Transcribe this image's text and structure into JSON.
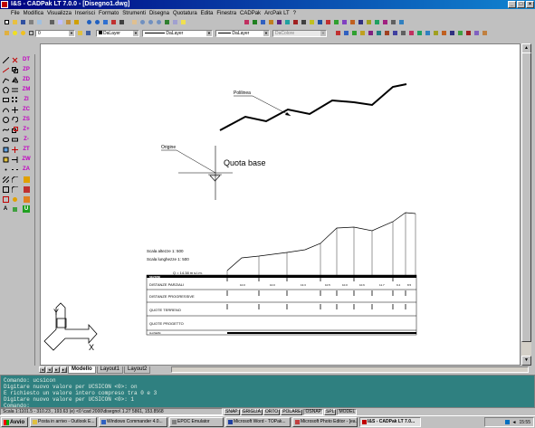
{
  "window": {
    "title": "I&S - CADPak LT 7.0.0 - [Disegno1.dwg]",
    "controls": [
      "_",
      "□",
      "×"
    ]
  },
  "menu": [
    "File",
    "Modifica",
    "Visualizza",
    "Inserisci",
    "Formato",
    "Strumenti",
    "Disegna",
    "Quotatura",
    "Edita",
    "Finestra",
    "CADPak",
    "ArcPak LT",
    "?"
  ],
  "properties_toolbar": {
    "layer_value": "0",
    "color_value": "DaLayer",
    "linetype_value": "DaLayer",
    "lineweight_value": "DaLayer",
    "plotstyle_value": "DaColore"
  },
  "left_toolbar": {
    "letters": [
      "DT",
      "ZP",
      "ZD",
      "ZM",
      "ZI",
      "ZC",
      "ZS",
      "Z+",
      "Z-",
      "ZT",
      "ZW",
      "ZA",
      "U"
    ]
  },
  "drawing": {
    "polyline_label": "Polilinea",
    "origin_label": "Origine",
    "quota_label": "Quota base",
    "scale_heights": "Scala altezze 1: 500",
    "scale_lengths": "Scala lunghezze 1: 500",
    "datum_label": "Q = 14.38 m s.l.m.",
    "table_header": "SEZIONI",
    "row_labels": [
      "DISTANZE PARZIALI",
      "DISTANZE PROGRESSIVE",
      "QUOTE TERRENO",
      "QUOTE PROGETTO",
      "ALLINEAM."
    ],
    "partial_distances": [
      "10.0",
      "10.0",
      "13.3",
      "10.5",
      "10.0",
      "10.6",
      "11.7",
      "9.4",
      "8.5"
    ],
    "ucs_y": "Y",
    "ucs_x": "X"
  },
  "tabs": {
    "nav": [
      "|◄",
      "◄",
      "►",
      "►|"
    ],
    "items": [
      "Modello",
      "Layout1",
      "Layout2"
    ],
    "active": "Modello"
  },
  "command_lines": [
    "Comando: ucsicon",
    "Digitare nuovo valore per UCSICON <0>: on",
    "E richiesto un valore intero compreso tra 0 e 3",
    "Digitare nuovo valore per UCSICON <0>: 1",
    "Comando:"
  ],
  "status": {
    "coords": "Scala 1:1101.5 - 310.23 , 193.63 (e) <0 \\cad 2000\\disegno\\ 1.27 5861,  153.8568",
    "buttons": [
      "SNAP",
      "GRIGLIA",
      "ORTO",
      "POLARE",
      "OSNAP",
      "SPL",
      "MODEL"
    ]
  },
  "taskbar": {
    "start": "Avvio",
    "tasks": [
      {
        "label": "Posta in arrivo - Outlook E...",
        "active": false
      },
      {
        "label": "Windows Commander 4.0...",
        "active": false
      },
      {
        "label": "EPOC Emulator",
        "active": false
      },
      {
        "label": "Microsoft Word - TOPak...",
        "active": false
      },
      {
        "label": "Microsoft Photo Editor - [ea...",
        "active": false
      },
      {
        "label": "I&S - CADPak LT 7.0...",
        "active": true
      }
    ],
    "clock": "15:55"
  }
}
